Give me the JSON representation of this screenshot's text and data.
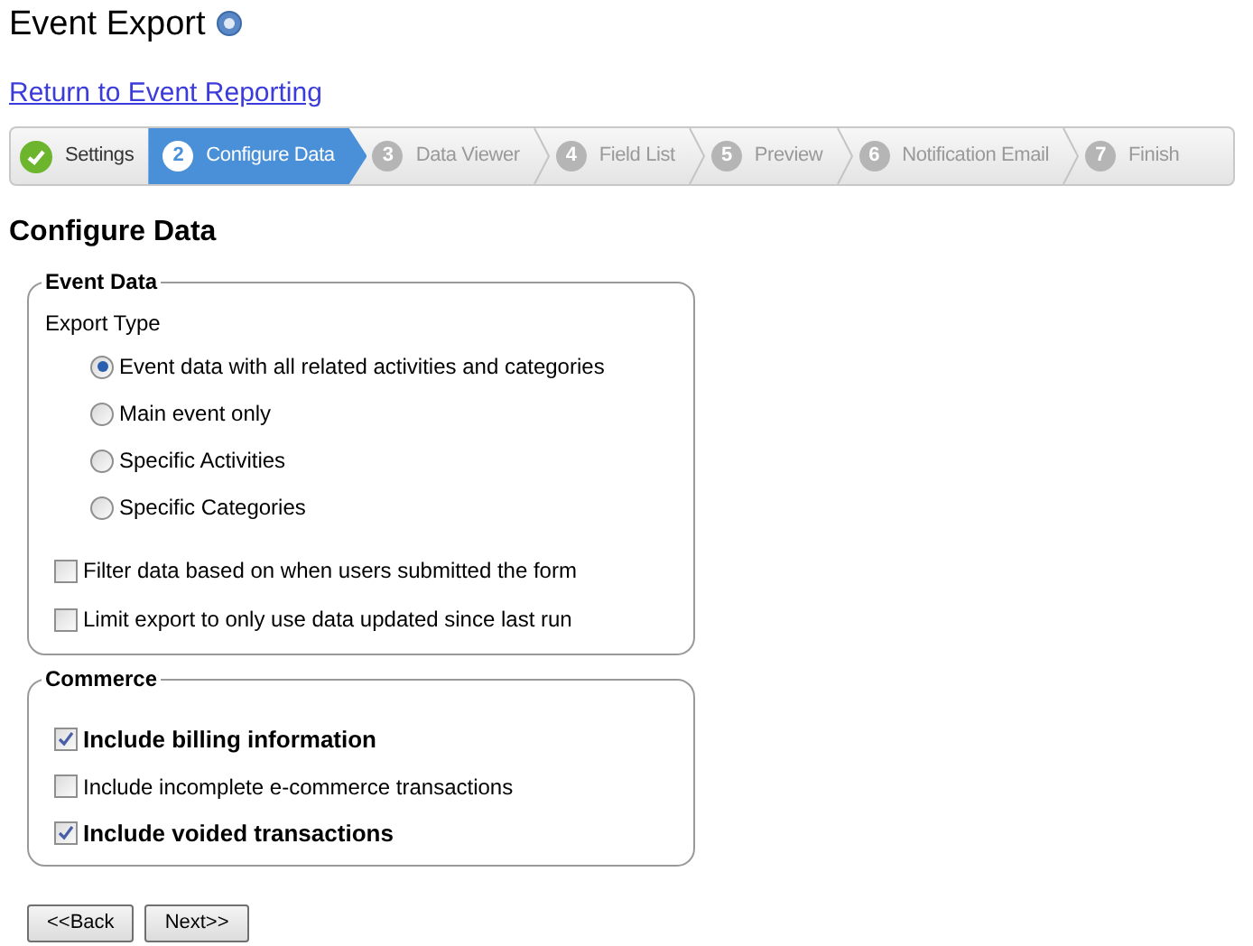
{
  "title": "Event Export",
  "return_link": "Return to Event Reporting",
  "steps": [
    {
      "label": "Settings",
      "completed": true,
      "selected": false
    },
    {
      "number": "2",
      "label": "Configure Data",
      "completed": false,
      "selected": true
    },
    {
      "number": "3",
      "label": "Data Viewer",
      "completed": false,
      "selected": false
    },
    {
      "number": "4",
      "label": "Field List",
      "completed": false,
      "selected": false
    },
    {
      "number": "5",
      "label": "Preview",
      "completed": false,
      "selected": false
    },
    {
      "number": "6",
      "label": "Notification Email",
      "completed": false,
      "selected": false
    },
    {
      "number": "7",
      "label": "Finish",
      "completed": false,
      "selected": false
    }
  ],
  "heading": "Configure Data",
  "event_data": {
    "legend": "Event Data",
    "export_type_label": "Export Type",
    "radios": [
      {
        "label": "Event data with all related activities and categories",
        "selected": true
      },
      {
        "label": "Main event only",
        "selected": false
      },
      {
        "label": "Specific Activities",
        "selected": false
      },
      {
        "label": "Specific Categories",
        "selected": false
      }
    ],
    "checkboxes": [
      {
        "label": "Filter data based on when users submitted the form",
        "checked": false,
        "bold": false
      },
      {
        "label": "Limit export to only use data updated since last run",
        "checked": false,
        "bold": false
      }
    ]
  },
  "commerce": {
    "legend": "Commerce",
    "checkboxes": [
      {
        "label": "Include billing information",
        "checked": true,
        "bold": true
      },
      {
        "label": "Include incomplete e-commerce transactions",
        "checked": false,
        "bold": false
      },
      {
        "label": "Include voided transactions",
        "checked": true,
        "bold": true
      }
    ]
  },
  "buttons": [
    "<<Back",
    "Next>>"
  ]
}
